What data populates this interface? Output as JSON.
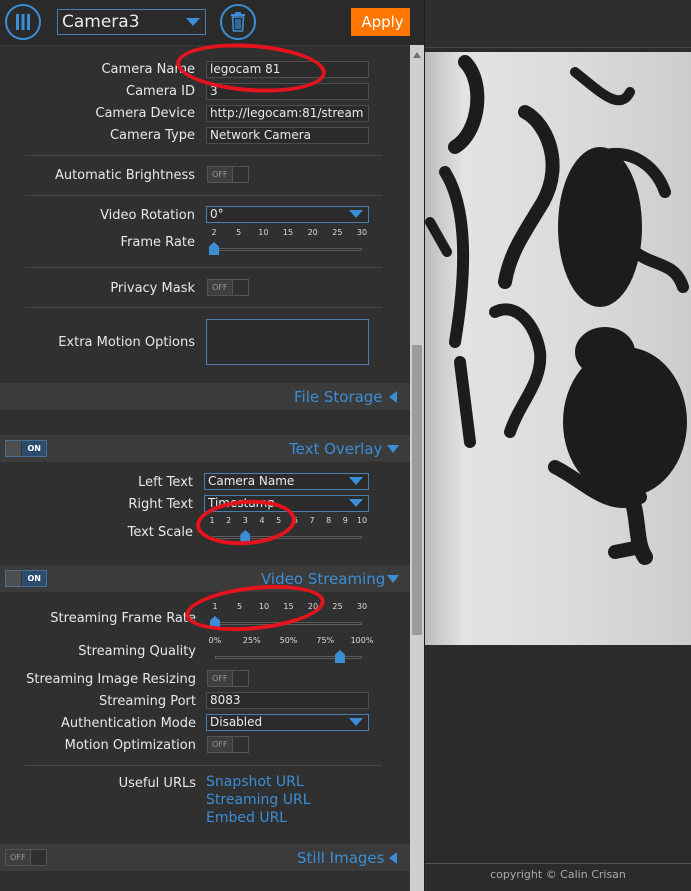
{
  "toolbar": {
    "camera_select": "Camera3",
    "apply_label": "Apply",
    "accent": "#3b8ed5",
    "apply_color": "#ff7700",
    "menu_icon": "vertical-bars-icon",
    "delete_icon": "trash-icon"
  },
  "device": {
    "camera_name_label": "Camera Name",
    "camera_name_value": "legocam 81",
    "camera_id_label": "Camera ID",
    "camera_id_value": "3",
    "camera_device_label": "Camera Device",
    "camera_device_value": "http://legocam:81/stream",
    "camera_type_label": "Camera Type",
    "camera_type_value": "Network Camera"
  },
  "video_device": {
    "auto_brightness_label": "Automatic Brightness",
    "auto_brightness_state": "OFF",
    "video_rotation_label": "Video Rotation",
    "video_rotation_value": "0°",
    "frame_rate_label": "Frame Rate",
    "frame_rate_ticks": [
      "2",
      "5",
      "10",
      "15",
      "20",
      "25",
      "30"
    ],
    "frame_rate_value": 2,
    "privacy_mask_label": "Privacy Mask",
    "privacy_mask_state": "OFF",
    "extra_motion_label": "Extra Motion Options",
    "extra_motion_value": ""
  },
  "file_storage": {
    "title": "File Storage"
  },
  "text_overlay": {
    "title": "Text Overlay",
    "toggle_state": "ON",
    "left_text_label": "Left Text",
    "left_text_value": "Camera Name",
    "right_text_label": "Right Text",
    "right_text_value": "Timestamp",
    "text_scale_label": "Text Scale",
    "text_scale_ticks": [
      "1",
      "2",
      "3",
      "4",
      "5",
      "6",
      "7",
      "8",
      "9",
      "10"
    ],
    "text_scale_value": 3
  },
  "video_streaming": {
    "title": "Video Streaming",
    "toggle_state": "ON",
    "frame_rate_label": "Streaming Frame Rate",
    "frame_rate_ticks": [
      "1",
      "5",
      "10",
      "15",
      "20",
      "25",
      "30"
    ],
    "frame_rate_value": 1,
    "quality_label": "Streaming Quality",
    "quality_ticks": [
      "0%",
      "25%",
      "50%",
      "75%",
      "100%"
    ],
    "quality_value_percent": 85,
    "resizing_label": "Streaming Image Resizing",
    "resizing_state": "OFF",
    "port_label": "Streaming Port",
    "port_value": "8083",
    "auth_label": "Authentication Mode",
    "auth_value": "Disabled",
    "motion_opt_label": "Motion Optimization",
    "motion_opt_state": "OFF",
    "urls_label": "Useful URLs",
    "snapshot_url": "Snapshot URL",
    "streaming_url": "Streaming URL",
    "embed_url": "Embed URL"
  },
  "still_images": {
    "title": "Still Images",
    "toggle_state": "OFF"
  },
  "footer": {
    "copyright": "copyright © Calin Crisan"
  }
}
